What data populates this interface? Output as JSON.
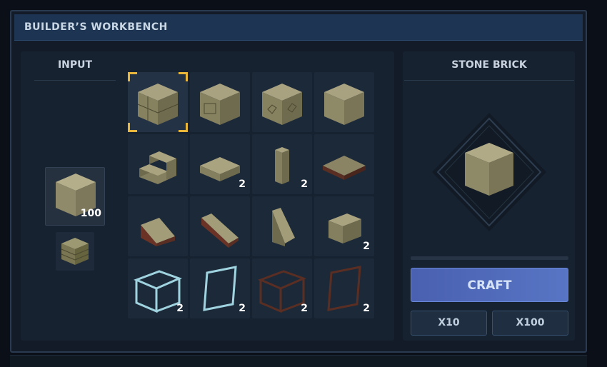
{
  "window": {
    "title": "BUILDER’S WORKBENCH"
  },
  "input": {
    "label": "INPUT",
    "item_icon": "stone-brick-cube-icon",
    "count": "100",
    "secondary_icon": "cobblestone-block-icon"
  },
  "recipes": [
    {
      "icon": "stone-brick-block-icon",
      "count": "",
      "selected": true
    },
    {
      "icon": "carved-stone-block-icon",
      "count": ""
    },
    {
      "icon": "chiseled-stone-block-icon",
      "count": ""
    },
    {
      "icon": "smooth-stone-block-icon",
      "count": ""
    },
    {
      "icon": "stone-stairs-icon",
      "count": ""
    },
    {
      "icon": "stone-slab-icon",
      "count": "2"
    },
    {
      "icon": "stone-pillar-icon",
      "count": "2"
    },
    {
      "icon": "stone-platform-icon",
      "count": ""
    },
    {
      "icon": "stone-ramp-icon",
      "count": ""
    },
    {
      "icon": "stone-diagonal-ramp-icon",
      "count": ""
    },
    {
      "icon": "stone-corner-ramp-icon",
      "count": ""
    },
    {
      "icon": "stone-half-wall-icon",
      "count": "2"
    },
    {
      "icon": "glass-frame-cube-icon",
      "count": "2"
    },
    {
      "icon": "glass-pane-icon",
      "count": "2"
    },
    {
      "icon": "wood-frame-cube-icon",
      "count": "2"
    },
    {
      "icon": "wood-pane-icon",
      "count": "2"
    }
  ],
  "output": {
    "title": "STONE BRICK",
    "preview_icon": "stone-brick-cube-icon",
    "progress": 0
  },
  "actions": {
    "craft_label": "CRAFT",
    "x10_label": "X10",
    "x100_label": "X100"
  },
  "colors": {
    "accent": "#5775c4",
    "selection": "#e8b63a",
    "stone": "#8c8766",
    "glass": "#9fd3df",
    "wood": "#5a2e22"
  }
}
